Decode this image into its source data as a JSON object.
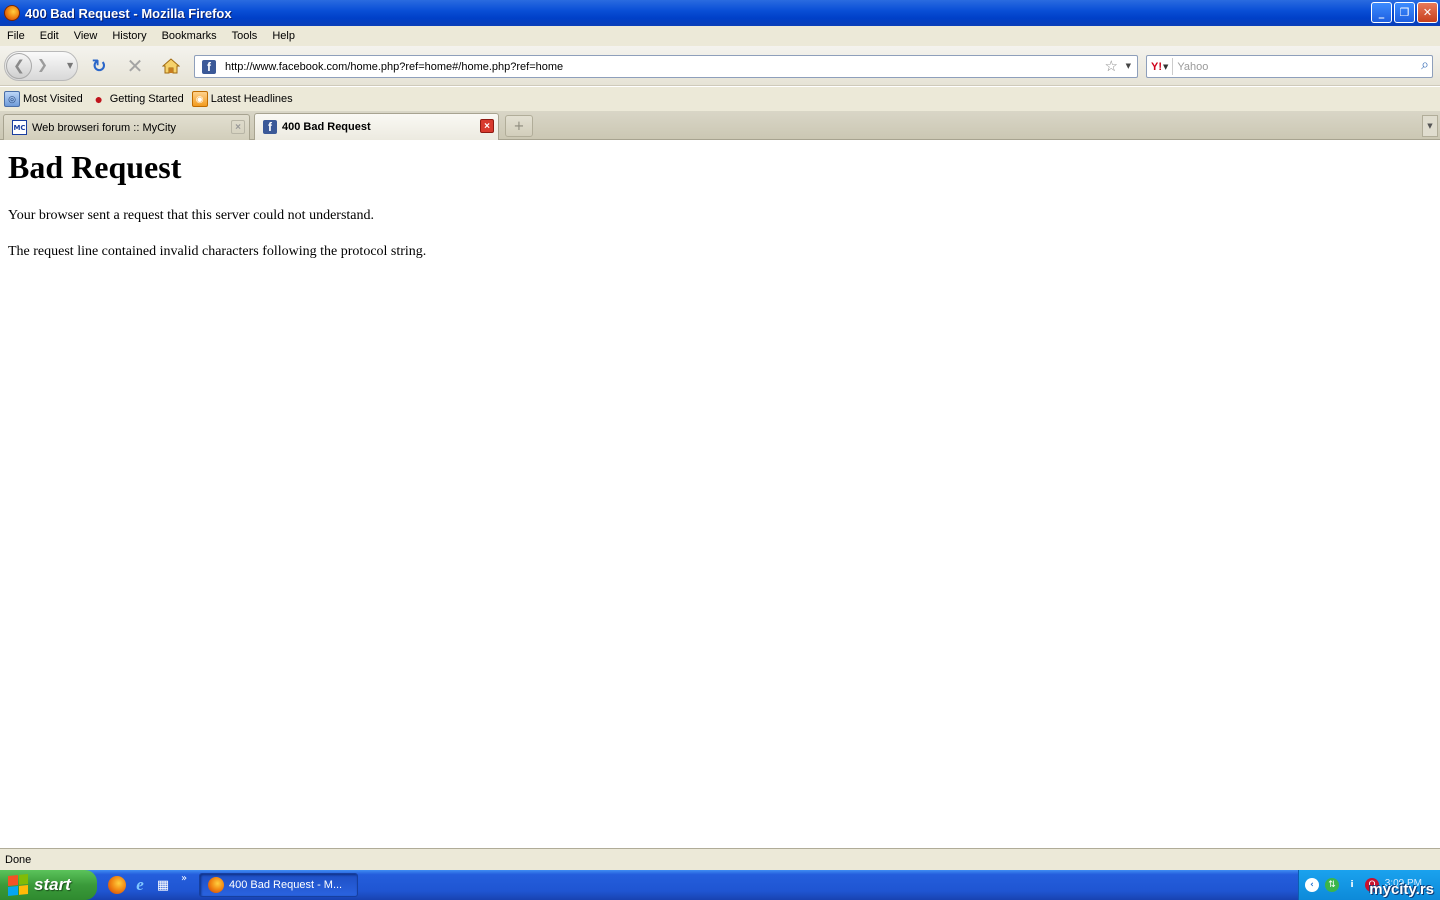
{
  "window": {
    "title": "400 Bad Request - Mozilla Firefox",
    "controls": {
      "minimize": "_",
      "maximize": "❐",
      "close": "✕"
    }
  },
  "menu": [
    "File",
    "Edit",
    "View",
    "History",
    "Bookmarks",
    "Tools",
    "Help"
  ],
  "navbar": {
    "url": "http://www.facebook.com/home.php?ref=home#/home.php?ref=home",
    "search_engine": "Y!",
    "search_placeholder": "Yahoo"
  },
  "bookmarks": [
    {
      "label": "Most Visited",
      "icon": "most-visited-icon"
    },
    {
      "label": "Getting Started",
      "icon": "firefox-getting-started-icon"
    },
    {
      "label": "Latest Headlines",
      "icon": "rss-feed-icon"
    }
  ],
  "tabs": [
    {
      "label": "Web browseri forum :: MyCity",
      "favicon": "MC",
      "active": false
    },
    {
      "label": "400 Bad Request",
      "favicon": "f",
      "active": true
    }
  ],
  "page": {
    "heading": "Bad Request",
    "paragraph1": "Your browser sent a request that this server could not understand.",
    "paragraph2": "The request line contained invalid characters following the protocol string."
  },
  "status": "Done",
  "taskbar": {
    "start_label": "start",
    "task_label": "400 Bad Request - M...",
    "clock": "3:09 PM",
    "watermark": "mycity.rs"
  },
  "colors": {
    "titlebar_blue": "#0a4fd6",
    "chrome_beige": "#ece9d8",
    "taskbar_blue": "#245edc",
    "start_green": "#3a9a3a",
    "facebook_blue": "#3b5998"
  }
}
